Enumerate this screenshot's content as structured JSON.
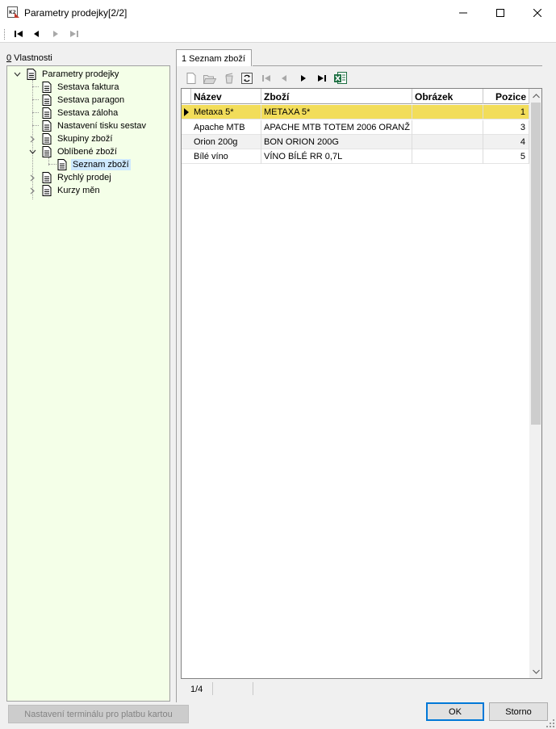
{
  "window": {
    "title": "Parametry prodejky[2/2]",
    "icon": "k2-app-icon"
  },
  "navbar": {
    "first": "first-record-icon",
    "prev": "previous-record-icon",
    "next": "next-record-icon",
    "last": "last-record-icon"
  },
  "left_panel": {
    "label_underlined": "0",
    "label_rest": " Vlastnosti",
    "tree": [
      {
        "label": "Parametry prodejky",
        "level": 0,
        "expanded": true
      },
      {
        "label": "Sestava faktura",
        "level": 1
      },
      {
        "label": "Sestava paragon",
        "level": 1
      },
      {
        "label": "Sestava záloha",
        "level": 1
      },
      {
        "label": "Nastavení tisku sestav",
        "level": 1
      },
      {
        "label": "Skupiny zboží",
        "level": 1,
        "expandable": true
      },
      {
        "label": "Oblíbené zboží",
        "level": 1,
        "expanded": true
      },
      {
        "label": "Seznam zboží",
        "level": 2,
        "selected": true
      },
      {
        "label": "Rychlý prodej",
        "level": 1,
        "expandable": true
      },
      {
        "label": "Kurzy měn",
        "level": 1,
        "expandable": true
      }
    ]
  },
  "tab": {
    "label": "1 Seznam zboží"
  },
  "grid": {
    "columns": [
      "Název",
      "Zboží",
      "Obrázek",
      "Pozice"
    ],
    "rows": [
      {
        "nazev": "Metaxa 5*",
        "zbozi": "METAXA 5*",
        "obrazek": "",
        "pozice": "1"
      },
      {
        "nazev": "Apache MTB",
        "zbozi": "APACHE MTB TOTEM 2006 ORANŽ",
        "obrazek": "",
        "pozice": "3"
      },
      {
        "nazev": "Orion 200g",
        "zbozi": "BON ORION 200G",
        "obrazek": "",
        "pozice": "4"
      },
      {
        "nazev": "Bílé víno",
        "zbozi": "VÍNO BÍLÉ RR 0,7L",
        "obrazek": "",
        "pozice": "5"
      }
    ],
    "current_row": 0
  },
  "status": {
    "record": "1/4"
  },
  "buttons": {
    "terminal": "Nastavení terminálu pro platbu kartou",
    "ok": "OK",
    "cancel": "Storno"
  },
  "colors": {
    "tree_bg": "#f4ffe8",
    "current_row": "#f2dd5a",
    "selection": "#cde8ff"
  }
}
